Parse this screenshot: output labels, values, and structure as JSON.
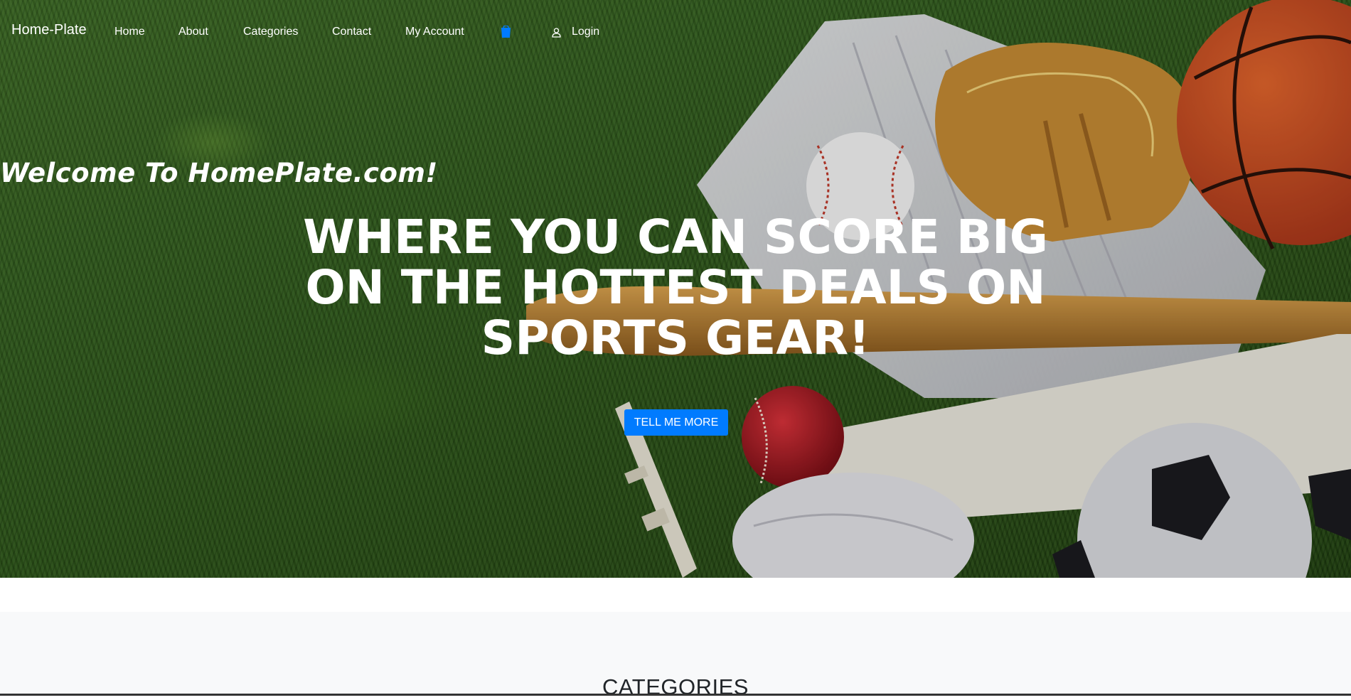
{
  "navbar": {
    "brand": "Home-Plate",
    "links": [
      "Home",
      "About",
      "Categories",
      "Contact",
      "My Account"
    ],
    "login": "Login",
    "cart_icon": "cart-icon",
    "user_icon": "user-icon",
    "cart_icon_color": "#007bff"
  },
  "hero": {
    "welcome": "Welcome To HomePlate.com!",
    "headline": "WHERE YOU CAN SCORE BIG ON THE HOTTEST DEALS ON SPORTS GEAR!",
    "cta_label": "TELL ME MORE",
    "cta_color": "#007bff"
  },
  "categories": {
    "heading": "CATEGORIES"
  }
}
